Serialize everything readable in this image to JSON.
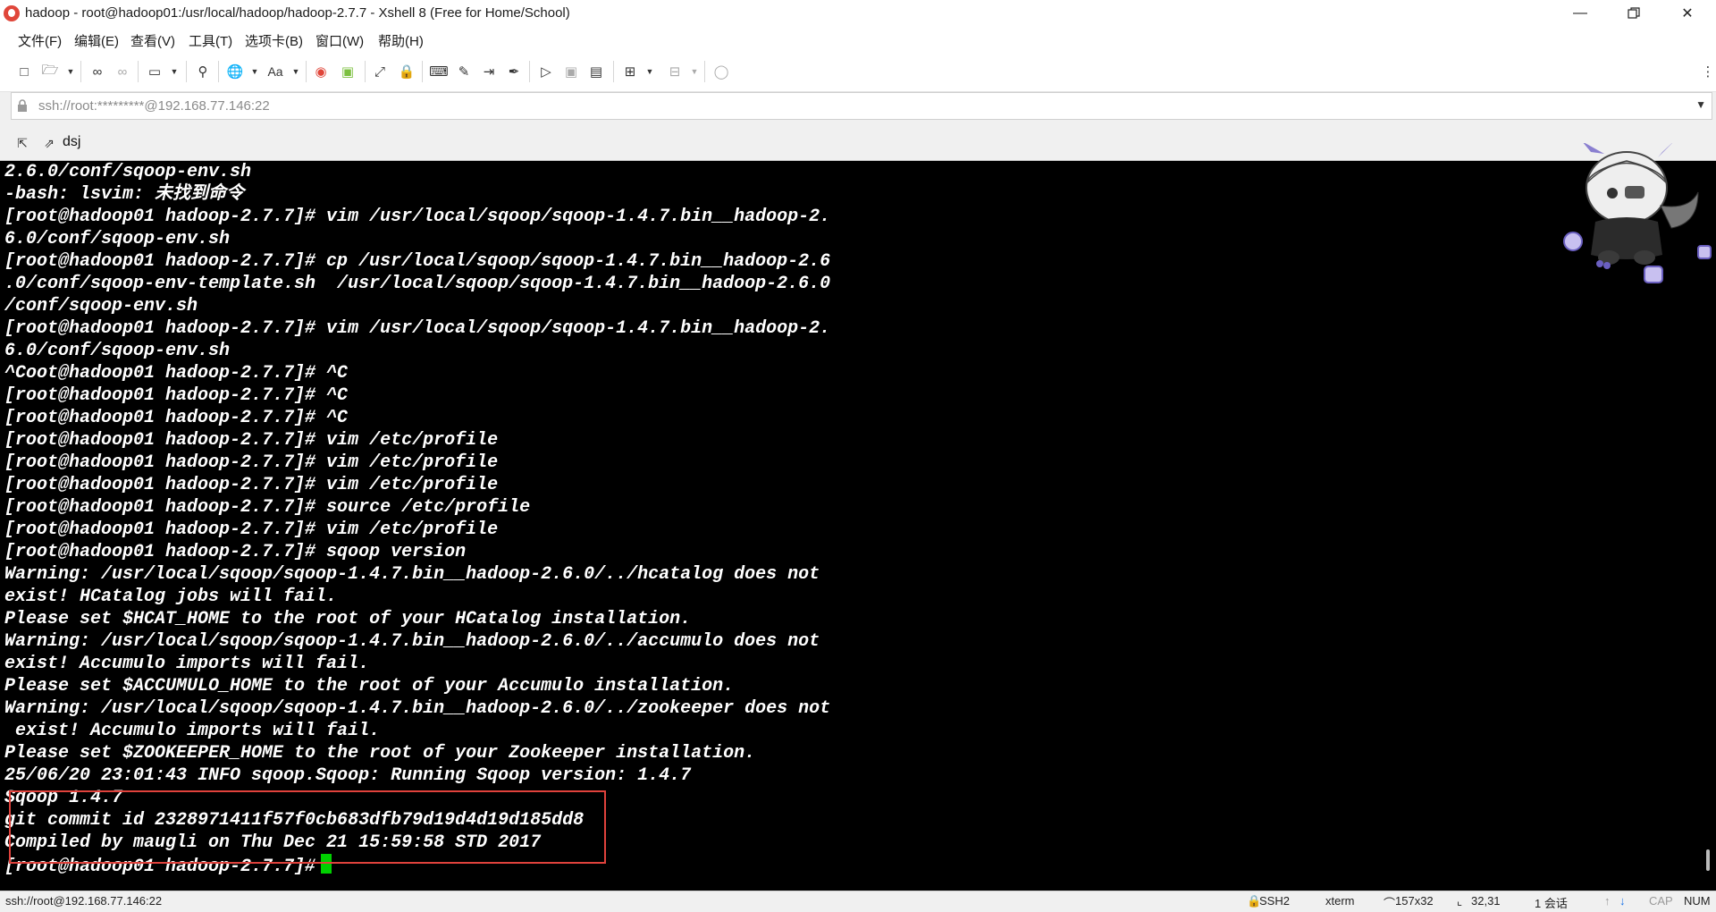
{
  "window": {
    "title": "hadoop - root@hadoop01:/usr/local/hadoop/hadoop-2.7.7 - Xshell 8 (Free for Home/School)"
  },
  "menu": [
    "文件(F)",
    "编辑(E)",
    "查看(V)",
    "工具(T)",
    "选项卡(B)",
    "窗口(W)",
    "帮助(H)"
  ],
  "toolbar": {
    "font_button_label": "Aa"
  },
  "address": {
    "value": "ssh://root:*********@192.168.77.146:22"
  },
  "tabs": {
    "session_label": "dsj"
  },
  "terminal": {
    "lines": [
      "2.6.0/conf/sqoop-env.sh",
      "-bash: lsvim: 未找到命令",
      "[root@hadoop01 hadoop-2.7.7]# vim /usr/local/sqoop/sqoop-1.4.7.bin__hadoop-2.",
      "6.0/conf/sqoop-env.sh",
      "[root@hadoop01 hadoop-2.7.7]# cp /usr/local/sqoop/sqoop-1.4.7.bin__hadoop-2.6",
      ".0/conf/sqoop-env-template.sh  /usr/local/sqoop/sqoop-1.4.7.bin__hadoop-2.6.0",
      "/conf/sqoop-env.sh",
      "[root@hadoop01 hadoop-2.7.7]# vim /usr/local/sqoop/sqoop-1.4.7.bin__hadoop-2.",
      "6.0/conf/sqoop-env.sh",
      "^Coot@hadoop01 hadoop-2.7.7]# ^C",
      "[root@hadoop01 hadoop-2.7.7]# ^C",
      "[root@hadoop01 hadoop-2.7.7]# ^C",
      "[root@hadoop01 hadoop-2.7.7]# vim /etc/profile",
      "[root@hadoop01 hadoop-2.7.7]# vim /etc/profile",
      "[root@hadoop01 hadoop-2.7.7]# vim /etc/profile",
      "[root@hadoop01 hadoop-2.7.7]# source /etc/profile",
      "[root@hadoop01 hadoop-2.7.7]# vim /etc/profile",
      "[root@hadoop01 hadoop-2.7.7]# sqoop version",
      "Warning: /usr/local/sqoop/sqoop-1.4.7.bin__hadoop-2.6.0/../hcatalog does not",
      "exist! HCatalog jobs will fail.",
      "Please set $HCAT_HOME to the root of your HCatalog installation.",
      "Warning: /usr/local/sqoop/sqoop-1.4.7.bin__hadoop-2.6.0/../accumulo does not",
      "exist! Accumulo imports will fail.",
      "Please set $ACCUMULO_HOME to the root of your Accumulo installation.",
      "Warning: /usr/local/sqoop/sqoop-1.4.7.bin__hadoop-2.6.0/../zookeeper does not",
      " exist! Accumulo imports will fail.",
      "Please set $ZOOKEEPER_HOME to the root of your Zookeeper installation.",
      "25/06/20 23:01:43 INFO sqoop.Sqoop: Running Sqoop version: 1.4.7",
      "Sqoop 1.4.7",
      "git commit id 2328971411f57f0cb683dfb79d19d4d19d185dd8",
      "Compiled by maugli on Thu Dec 21 15:59:58 STD 2017"
    ],
    "prompt": "[root@hadoop01 hadoop-2.7.7]#",
    "colors": {
      "background": "#000000",
      "text": "#ffffff",
      "cursor": "#00d000",
      "highlight_box": "#e0423c"
    }
  },
  "status": {
    "connection": "ssh://root@192.168.77.146:22",
    "protocol": "SSH2",
    "term_type": "xterm",
    "size": "157x32",
    "cursor_pos": "32,31",
    "sessions": "1 会话",
    "caps": "CAP",
    "num": "NUM"
  }
}
